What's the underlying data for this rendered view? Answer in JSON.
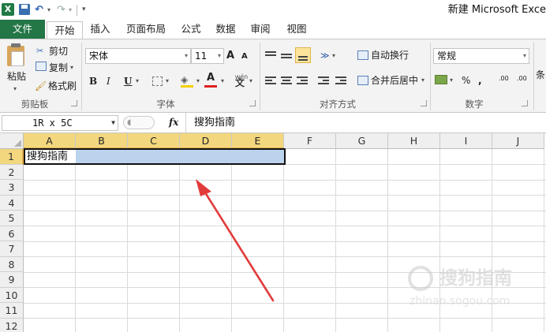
{
  "app": {
    "icon_label": "X",
    "window_title": "新建 Microsoft Exce",
    "quick_access": {
      "undo_dropdown": "▾",
      "redo_dropdown": "▾",
      "customize": "▾"
    }
  },
  "tabs": [
    {
      "label": "文件",
      "active": false
    },
    {
      "label": "开始",
      "active": true
    },
    {
      "label": "插入"
    },
    {
      "label": "页面布局"
    },
    {
      "label": "公式"
    },
    {
      "label": "数据"
    },
    {
      "label": "审阅"
    },
    {
      "label": "视图"
    }
  ],
  "ribbon": {
    "clipboard": {
      "group_label": "剪贴板",
      "paste": "粘贴",
      "cut": "剪切",
      "copy": "复制",
      "format_painter": "格式刷",
      "paste_dropdown": "▾"
    },
    "font": {
      "group_label": "字体",
      "font_name": "宋体",
      "font_size": "11",
      "bold": "B",
      "italic": "I",
      "underline": "U",
      "grow": "A",
      "shrink": "A",
      "font_color_letter": "A",
      "phonetic": "wén",
      "font_color": "#e02020",
      "fill_color": "#f5d000"
    },
    "alignment": {
      "group_label": "对齐方式",
      "wrap_text": "自动换行",
      "merge_center": "合并后居中"
    },
    "number": {
      "group_label": "数字",
      "format": "常规",
      "percent": "%",
      "comma": ",",
      "increase_decimal": ".00",
      "decrease_decimal": ".00"
    },
    "styles": {
      "partial_label": "条"
    }
  },
  "formula_bar": {
    "name_box": "1R x 5C",
    "fx": "fx",
    "content": "搜狗指南"
  },
  "sheet": {
    "columns": [
      "A",
      "B",
      "C",
      "D",
      "E",
      "F",
      "G",
      "H",
      "I",
      "J"
    ],
    "selected_columns": [
      "A",
      "B",
      "C",
      "D",
      "E"
    ],
    "rows": [
      "1",
      "2",
      "3",
      "4",
      "5",
      "6",
      "7",
      "8",
      "9",
      "10",
      "11",
      "12"
    ],
    "selected_rows": [
      "1"
    ],
    "cell_a1": "搜狗指南"
  },
  "watermark": {
    "text": "搜狗指南",
    "url": "zhinan.sogou.com"
  },
  "colors": {
    "file_tab": "#237645",
    "selection_fill": "#bcd3ee",
    "header_highlight": "#f3d77e",
    "arrow": "#e23b3b"
  }
}
